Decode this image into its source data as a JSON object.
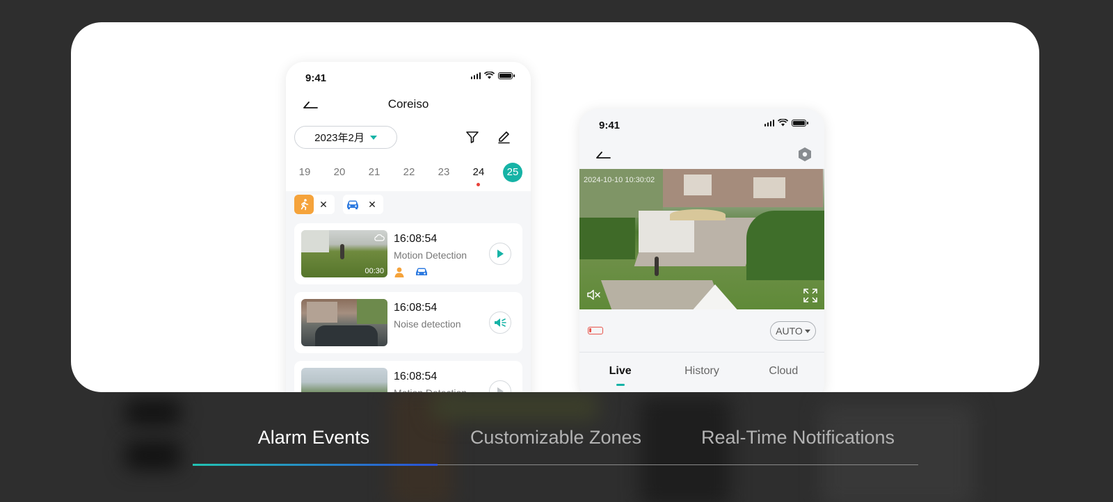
{
  "colors": {
    "accent": "#16b3a6",
    "person": "#f5a33b",
    "vehicle": "#2f7be0",
    "backdrop": "#2e2e2e"
  },
  "phone1": {
    "time": "9:41",
    "title": "Coreiso",
    "month": "2023年2月",
    "days": [
      "19",
      "20",
      "21",
      "22",
      "23",
      "24",
      "25"
    ],
    "events": [
      {
        "time": "16:08:54",
        "type": "Motion Detection",
        "duration": "00:30",
        "action_icon": "play-icon"
      },
      {
        "time": "16:08:54",
        "type": "Noise detection",
        "action_icon": "speaker-icon"
      },
      {
        "time": "16:08:54",
        "type": "Motion Detection",
        "action_icon": "play-icon"
      }
    ]
  },
  "phone2": {
    "time": "9:41",
    "timestamp": "2024-10-10 10:30:02",
    "quality": "AUTO",
    "tabs": [
      "Live",
      "History",
      "Cloud"
    ]
  },
  "features": [
    "Alarm Events",
    "Customizable Zones",
    "Real-Time Notifications"
  ]
}
